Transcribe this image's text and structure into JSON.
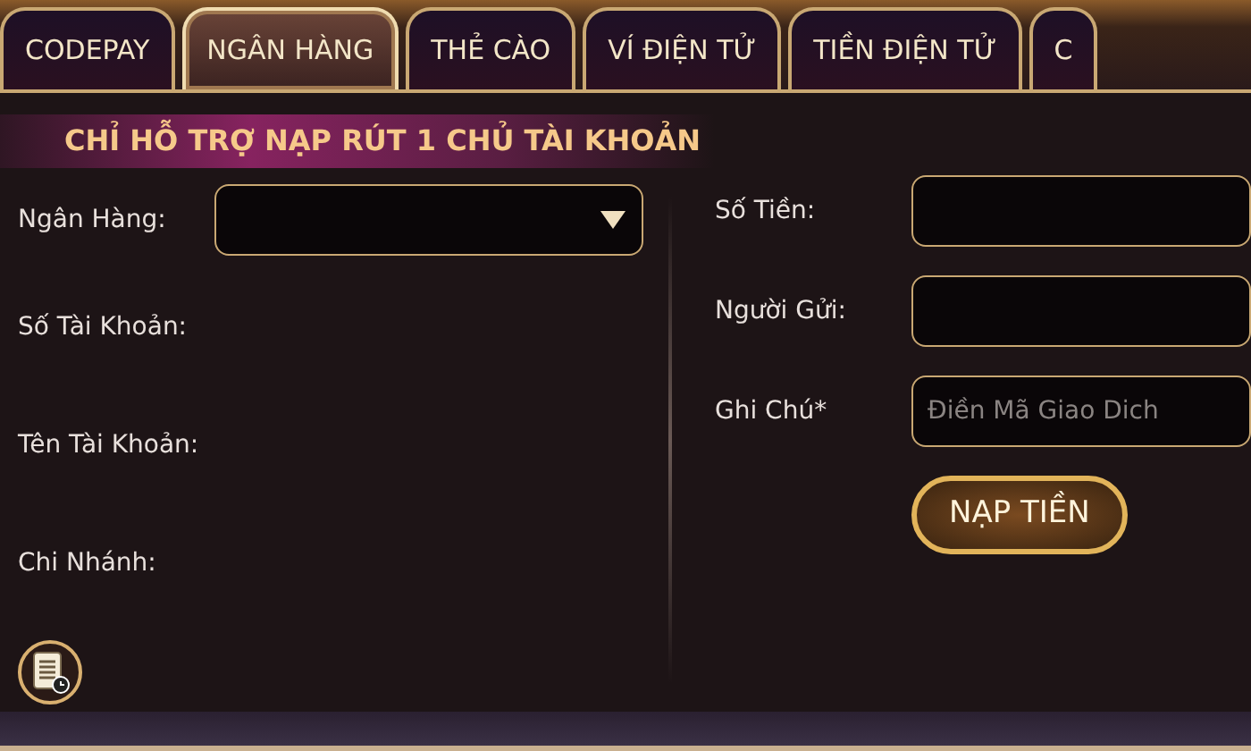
{
  "tabs": [
    {
      "label": "CODEPAY",
      "selected": false
    },
    {
      "label": "NGÂN HÀNG",
      "selected": true
    },
    {
      "label": "THẺ CÀO",
      "selected": false
    },
    {
      "label": "VÍ ĐIỆN TỬ",
      "selected": false
    },
    {
      "label": "TIỀN ĐIỆN TỬ",
      "selected": false
    },
    {
      "label": "C",
      "selected": false
    }
  ],
  "banner": "CHỈ HỖ TRỢ NẠP RÚT 1 CHỦ TÀI KHOẢN",
  "left_fields": [
    {
      "label": "Ngân Hàng:",
      "kind": "dropdown"
    },
    {
      "label": "Số Tài Khoản:",
      "kind": "text"
    },
    {
      "label": "Tên Tài Khoản:",
      "kind": "text"
    },
    {
      "label": "Chi Nhánh:",
      "kind": "text"
    }
  ],
  "right_fields": [
    {
      "label": "Số Tiền:",
      "kind": "input"
    },
    {
      "label": "Người Gửi:",
      "kind": "input"
    },
    {
      "label": "Ghi Chú*",
      "kind": "input",
      "placeholder": "Điền Mã Giao Dich"
    }
  ],
  "submit_button": "NẠP TIỀN"
}
